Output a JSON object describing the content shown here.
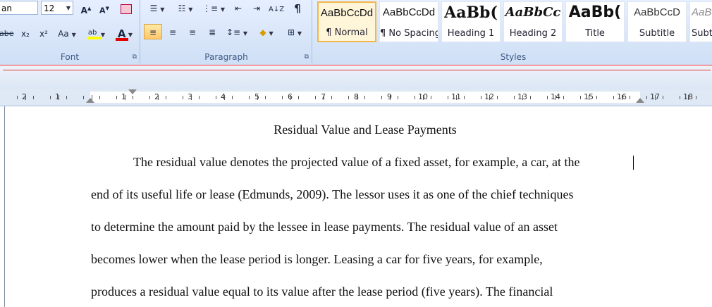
{
  "font_group": {
    "font_name": "an",
    "font_size": "12",
    "grow_label": "A",
    "shrink_label": "A",
    "strike_label": "abe",
    "subscript_label": "x₂",
    "superscript_label": "x²",
    "case_label": "Aa",
    "highlight_label": "ab",
    "font_color_label": "A",
    "label": "Font"
  },
  "paragraph_group": {
    "label": "Paragraph",
    "pilcrow": "¶"
  },
  "styles_group": {
    "label": "Styles",
    "items": [
      {
        "sample": "AaBbCcDd",
        "name": "¶ Normal"
      },
      {
        "sample": "AaBbCcDd",
        "name": "¶ No Spacing"
      },
      {
        "sample": "AaBb(",
        "name": "Heading 1"
      },
      {
        "sample": "AaBbCc",
        "name": "Heading 2"
      },
      {
        "sample": "AaBb(",
        "name": "Title"
      },
      {
        "sample": "AaBbCcD",
        "name": "Subtitle"
      },
      {
        "sample": "AaB",
        "name": "Subt"
      }
    ]
  },
  "ruler": {
    "labels": [
      "2",
      "1",
      "1",
      "2",
      "3",
      "4",
      "5",
      "6",
      "7",
      "8",
      "9",
      "10",
      "11",
      "12",
      "13",
      "14",
      "15",
      "16",
      "17",
      "18"
    ]
  },
  "document": {
    "title": "Residual Value and Lease Payments",
    "lines": [
      "The residual value denotes the projected value of a fixed asset, for example, a car, at the",
      "end of its useful life or lease (Edmunds, 2009). The lessor uses it as one of the chief techniques",
      "to determine the amount paid by the lessee in lease payments. The residual value of an asset",
      "becomes lower when the lease period is longer. Leasing a car for five years, for example,",
      "produces a residual value equal to its value after the lease period (five years). The financial"
    ]
  }
}
